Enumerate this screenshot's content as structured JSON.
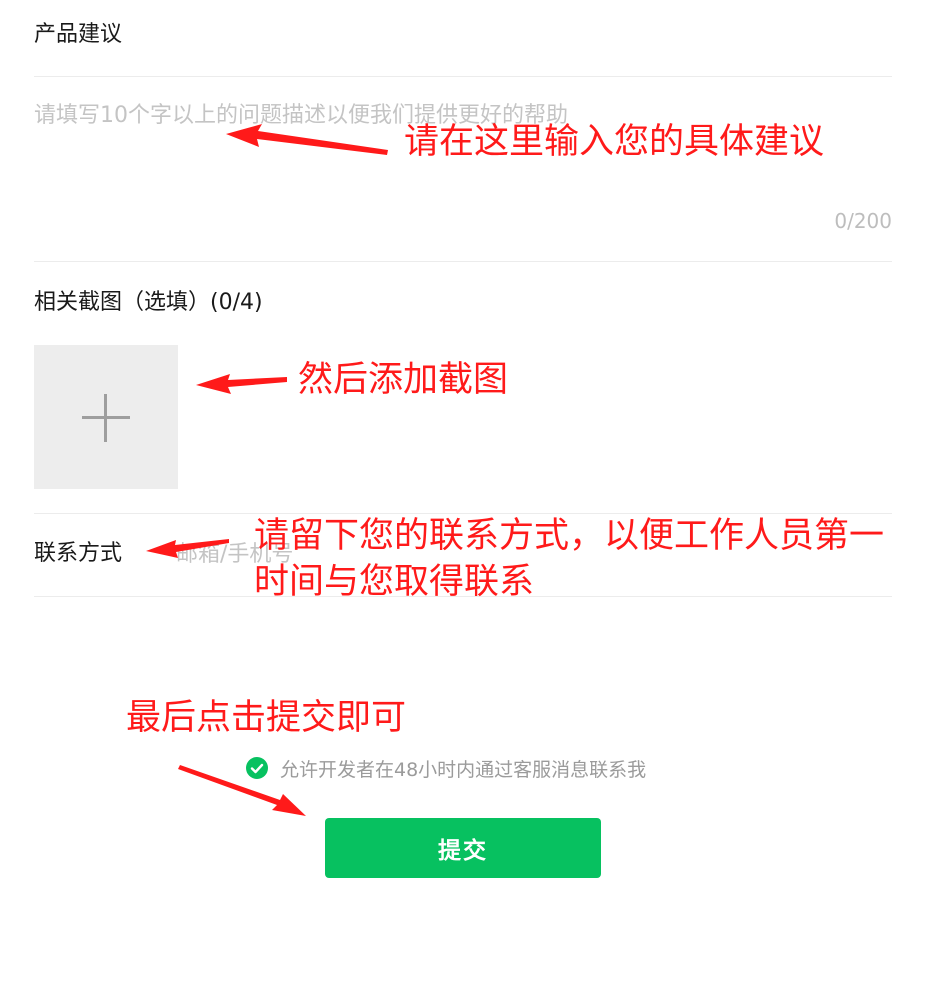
{
  "feedback": {
    "category_title": "产品建议",
    "description_placeholder": "请填写10个字以上的问题描述以便我们提供更好的帮助",
    "description_value": "",
    "char_counter": "0/200",
    "screenshot_title": "相关截图（选填）(0/4)",
    "contact_label": "联系方式",
    "contact_placeholder": "邮箱/手机号",
    "contact_value": "",
    "consent_text": "允许开发者在48小时内通过客服消息联系我",
    "consent_checked": true,
    "submit_label": "提交"
  },
  "annotations": {
    "input_hint": "请在这里输入您的具体建议",
    "screenshot_hint": "然后添加截图",
    "contact_hint_line1": "请留下您的联系方式，以便工作人员第一",
    "contact_hint_line2": "时间与您取得联系",
    "submit_hint": "最后点击提交即可"
  },
  "colors": {
    "accent": "#07c160",
    "annotation": "#ff1a1a",
    "placeholder": "#c4c4c4",
    "upload_bg": "#ededed"
  },
  "icons": {
    "upload": "plus-icon",
    "consent": "check-circle-icon"
  }
}
